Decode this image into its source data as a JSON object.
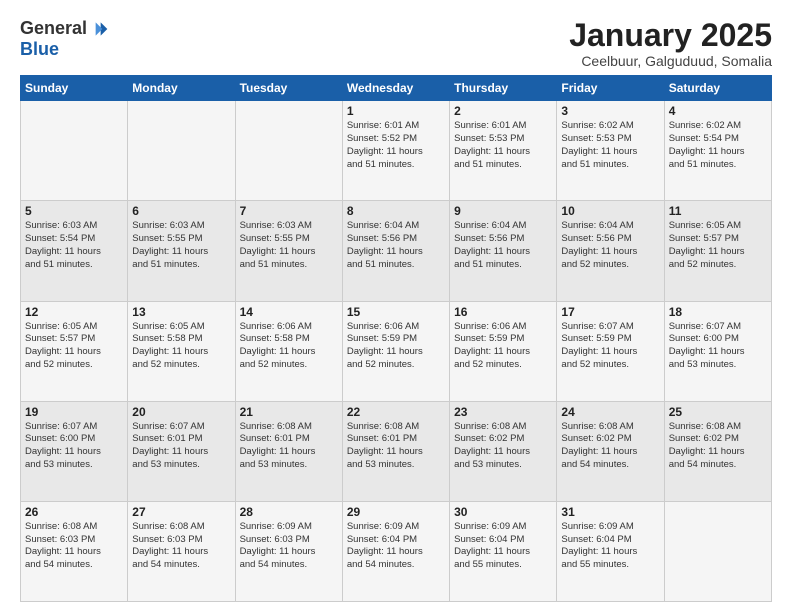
{
  "logo": {
    "general": "General",
    "blue": "Blue"
  },
  "title": "January 2025",
  "location": "Ceelbuur, Galguduud, Somalia",
  "days_of_week": [
    "Sunday",
    "Monday",
    "Tuesday",
    "Wednesday",
    "Thursday",
    "Friday",
    "Saturday"
  ],
  "weeks": [
    [
      {
        "day": "",
        "info": ""
      },
      {
        "day": "",
        "info": ""
      },
      {
        "day": "",
        "info": ""
      },
      {
        "day": "1",
        "info": "Sunrise: 6:01 AM\nSunset: 5:52 PM\nDaylight: 11 hours\nand 51 minutes."
      },
      {
        "day": "2",
        "info": "Sunrise: 6:01 AM\nSunset: 5:53 PM\nDaylight: 11 hours\nand 51 minutes."
      },
      {
        "day": "3",
        "info": "Sunrise: 6:02 AM\nSunset: 5:53 PM\nDaylight: 11 hours\nand 51 minutes."
      },
      {
        "day": "4",
        "info": "Sunrise: 6:02 AM\nSunset: 5:54 PM\nDaylight: 11 hours\nand 51 minutes."
      }
    ],
    [
      {
        "day": "5",
        "info": "Sunrise: 6:03 AM\nSunset: 5:54 PM\nDaylight: 11 hours\nand 51 minutes."
      },
      {
        "day": "6",
        "info": "Sunrise: 6:03 AM\nSunset: 5:55 PM\nDaylight: 11 hours\nand 51 minutes."
      },
      {
        "day": "7",
        "info": "Sunrise: 6:03 AM\nSunset: 5:55 PM\nDaylight: 11 hours\nand 51 minutes."
      },
      {
        "day": "8",
        "info": "Sunrise: 6:04 AM\nSunset: 5:56 PM\nDaylight: 11 hours\nand 51 minutes."
      },
      {
        "day": "9",
        "info": "Sunrise: 6:04 AM\nSunset: 5:56 PM\nDaylight: 11 hours\nand 51 minutes."
      },
      {
        "day": "10",
        "info": "Sunrise: 6:04 AM\nSunset: 5:56 PM\nDaylight: 11 hours\nand 52 minutes."
      },
      {
        "day": "11",
        "info": "Sunrise: 6:05 AM\nSunset: 5:57 PM\nDaylight: 11 hours\nand 52 minutes."
      }
    ],
    [
      {
        "day": "12",
        "info": "Sunrise: 6:05 AM\nSunset: 5:57 PM\nDaylight: 11 hours\nand 52 minutes."
      },
      {
        "day": "13",
        "info": "Sunrise: 6:05 AM\nSunset: 5:58 PM\nDaylight: 11 hours\nand 52 minutes."
      },
      {
        "day": "14",
        "info": "Sunrise: 6:06 AM\nSunset: 5:58 PM\nDaylight: 11 hours\nand 52 minutes."
      },
      {
        "day": "15",
        "info": "Sunrise: 6:06 AM\nSunset: 5:59 PM\nDaylight: 11 hours\nand 52 minutes."
      },
      {
        "day": "16",
        "info": "Sunrise: 6:06 AM\nSunset: 5:59 PM\nDaylight: 11 hours\nand 52 minutes."
      },
      {
        "day": "17",
        "info": "Sunrise: 6:07 AM\nSunset: 5:59 PM\nDaylight: 11 hours\nand 52 minutes."
      },
      {
        "day": "18",
        "info": "Sunrise: 6:07 AM\nSunset: 6:00 PM\nDaylight: 11 hours\nand 53 minutes."
      }
    ],
    [
      {
        "day": "19",
        "info": "Sunrise: 6:07 AM\nSunset: 6:00 PM\nDaylight: 11 hours\nand 53 minutes."
      },
      {
        "day": "20",
        "info": "Sunrise: 6:07 AM\nSunset: 6:01 PM\nDaylight: 11 hours\nand 53 minutes."
      },
      {
        "day": "21",
        "info": "Sunrise: 6:08 AM\nSunset: 6:01 PM\nDaylight: 11 hours\nand 53 minutes."
      },
      {
        "day": "22",
        "info": "Sunrise: 6:08 AM\nSunset: 6:01 PM\nDaylight: 11 hours\nand 53 minutes."
      },
      {
        "day": "23",
        "info": "Sunrise: 6:08 AM\nSunset: 6:02 PM\nDaylight: 11 hours\nand 53 minutes."
      },
      {
        "day": "24",
        "info": "Sunrise: 6:08 AM\nSunset: 6:02 PM\nDaylight: 11 hours\nand 54 minutes."
      },
      {
        "day": "25",
        "info": "Sunrise: 6:08 AM\nSunset: 6:02 PM\nDaylight: 11 hours\nand 54 minutes."
      }
    ],
    [
      {
        "day": "26",
        "info": "Sunrise: 6:08 AM\nSunset: 6:03 PM\nDaylight: 11 hours\nand 54 minutes."
      },
      {
        "day": "27",
        "info": "Sunrise: 6:08 AM\nSunset: 6:03 PM\nDaylight: 11 hours\nand 54 minutes."
      },
      {
        "day": "28",
        "info": "Sunrise: 6:09 AM\nSunset: 6:03 PM\nDaylight: 11 hours\nand 54 minutes."
      },
      {
        "day": "29",
        "info": "Sunrise: 6:09 AM\nSunset: 6:04 PM\nDaylight: 11 hours\nand 54 minutes."
      },
      {
        "day": "30",
        "info": "Sunrise: 6:09 AM\nSunset: 6:04 PM\nDaylight: 11 hours\nand 55 minutes."
      },
      {
        "day": "31",
        "info": "Sunrise: 6:09 AM\nSunset: 6:04 PM\nDaylight: 11 hours\nand 55 minutes."
      },
      {
        "day": "",
        "info": ""
      }
    ]
  ]
}
